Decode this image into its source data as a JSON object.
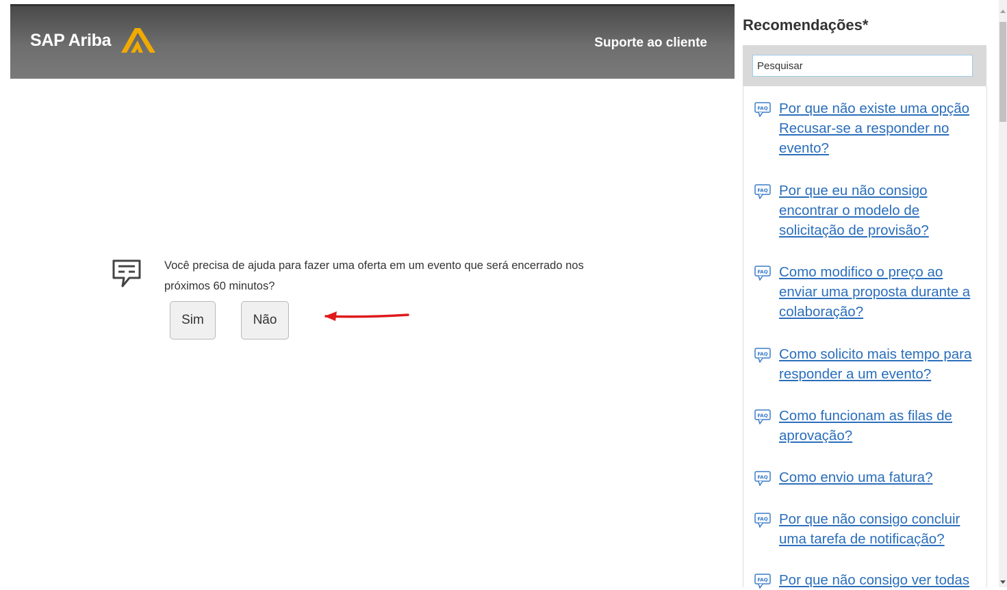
{
  "header": {
    "brand": "SAP Ariba",
    "support_link": "Suporte ao cliente"
  },
  "prompt": {
    "question": "Você precisa de ajuda para fazer uma oferta em um evento que será encerrado nos próximos 60 minutos?",
    "yes_label": "Sim",
    "no_label": "Não"
  },
  "sidebar": {
    "title": "Recomendações*",
    "search_placeholder": "Pesquisar",
    "items": [
      {
        "label": "Por que não existe uma opção Recusar-se a responder no evento?"
      },
      {
        "label": "Por que eu não consigo encontrar o modelo de solicitação de provisão?"
      },
      {
        "label": "Como modifico o preço ao enviar uma proposta durante a colaboração?"
      },
      {
        "label": "Como solicito mais tempo para responder a um evento?"
      },
      {
        "label": "Como funcionam as filas de aprovação?"
      },
      {
        "label": "Como envio uma fatura?"
      },
      {
        "label": "Por que não consigo concluir uma tarefa de notificação?"
      },
      {
        "label": "Por que não consigo ver todas"
      }
    ]
  },
  "colors": {
    "link": "#2a6ebb",
    "logo_accent": "#f0ab00",
    "arrow": "#e0191b"
  }
}
